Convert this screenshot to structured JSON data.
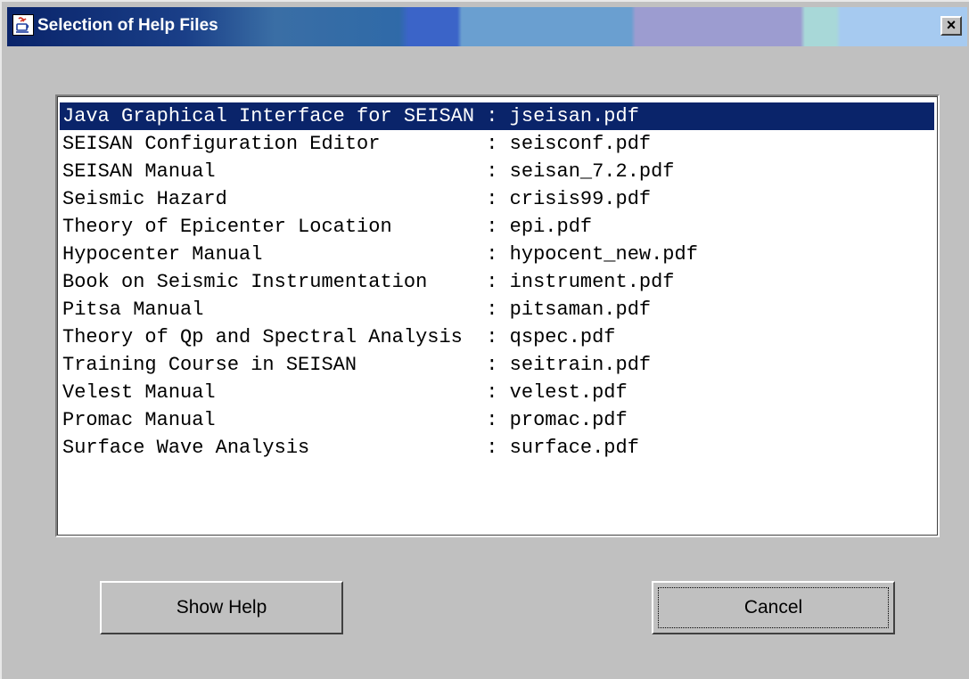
{
  "window": {
    "title": "Selection of Help Files",
    "close_label": "×"
  },
  "list": {
    "selected_index": 0,
    "items": [
      {
        "name": "Java Graphical Interface for SEISAN",
        "file": "jseisan.pdf"
      },
      {
        "name": "SEISAN Configuration Editor",
        "file": "seisconf.pdf"
      },
      {
        "name": "SEISAN Manual",
        "file": "seisan_7.2.pdf"
      },
      {
        "name": "Seismic Hazard",
        "file": "crisis99.pdf"
      },
      {
        "name": "Theory of Epicenter Location",
        "file": "epi.pdf"
      },
      {
        "name": "Hypocenter Manual",
        "file": "hypocent_new.pdf"
      },
      {
        "name": "Book on Seismic Instrumentation",
        "file": "instrument.pdf"
      },
      {
        "name": "Pitsa Manual",
        "file": "pitsaman.pdf"
      },
      {
        "name": "Theory of Qp and Spectral Analysis",
        "file": "qspec.pdf"
      },
      {
        "name": "Training Course in SEISAN",
        "file": "seitrain.pdf"
      },
      {
        "name": "Velest Manual",
        "file": "velest.pdf"
      },
      {
        "name": "Promac Manual",
        "file": "promac.pdf"
      },
      {
        "name": "Surface Wave Analysis",
        "file": "surface.pdf"
      }
    ]
  },
  "buttons": {
    "show_help": "Show Help",
    "cancel": "Cancel"
  },
  "colors": {
    "selection": "#0a246a",
    "dialog_bg": "#c0c0c0"
  }
}
